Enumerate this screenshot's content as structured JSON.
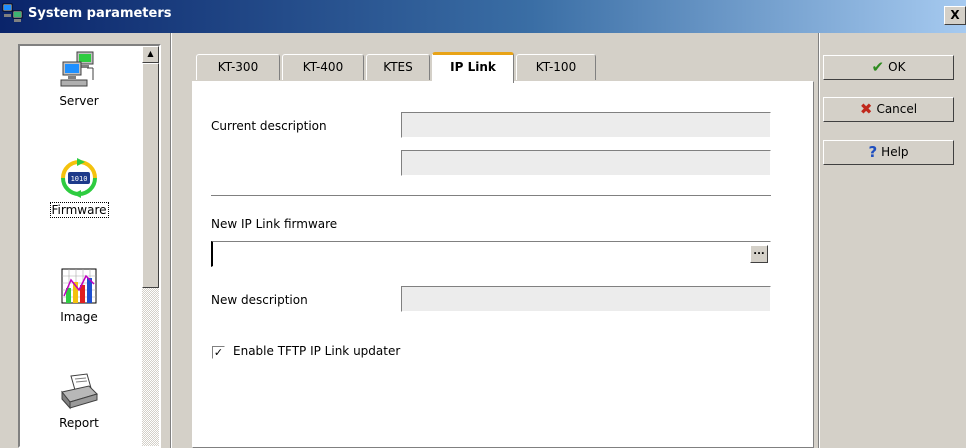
{
  "window": {
    "title": "System parameters",
    "close_glyph": "X",
    "icon": "network-computers-icon"
  },
  "nav": {
    "items": [
      {
        "label": "Server",
        "icon": "server-computers-icon",
        "selected": false
      },
      {
        "label": "Firmware",
        "icon": "firmware-cycle-icon",
        "selected": true
      },
      {
        "label": "Image",
        "icon": "chart-image-icon",
        "selected": false
      },
      {
        "label": "Report",
        "icon": "printer-icon",
        "selected": false
      }
    ],
    "scroll_up_glyph": "▲"
  },
  "tabs": [
    {
      "label": "KT-300",
      "active": false
    },
    {
      "label": "KT-400",
      "active": false
    },
    {
      "label": "KTES",
      "active": false
    },
    {
      "label": "IP Link",
      "active": true
    },
    {
      "label": "KT-100",
      "active": false
    }
  ],
  "form": {
    "current_description_label": "Current description",
    "current_description_line1": "",
    "current_description_line2": "",
    "new_firmware_label": "New IP Link firmware",
    "new_firmware_value": "",
    "browse_glyph": "...",
    "new_description_label": "New description",
    "new_description_value": "",
    "tftp_checkbox_label": "Enable TFTP IP Link updater",
    "tftp_checked": true,
    "check_glyph": "✓"
  },
  "buttons": {
    "ok": {
      "label": "OK",
      "icon": "checkmark-icon",
      "glyph": "✔",
      "color": "#2e8b1f"
    },
    "cancel": {
      "label": "Cancel",
      "icon": "cross-icon",
      "glyph": "✖",
      "color": "#c0281b"
    },
    "help": {
      "label": "Help",
      "icon": "question-icon",
      "glyph": "?",
      "color": "#1f4fbf"
    }
  },
  "colors": {
    "titlebar_start": "#0a246a",
    "titlebar_end": "#a6caf0",
    "tab_highlight": "#e8a317",
    "face": "#d4d0c8"
  }
}
